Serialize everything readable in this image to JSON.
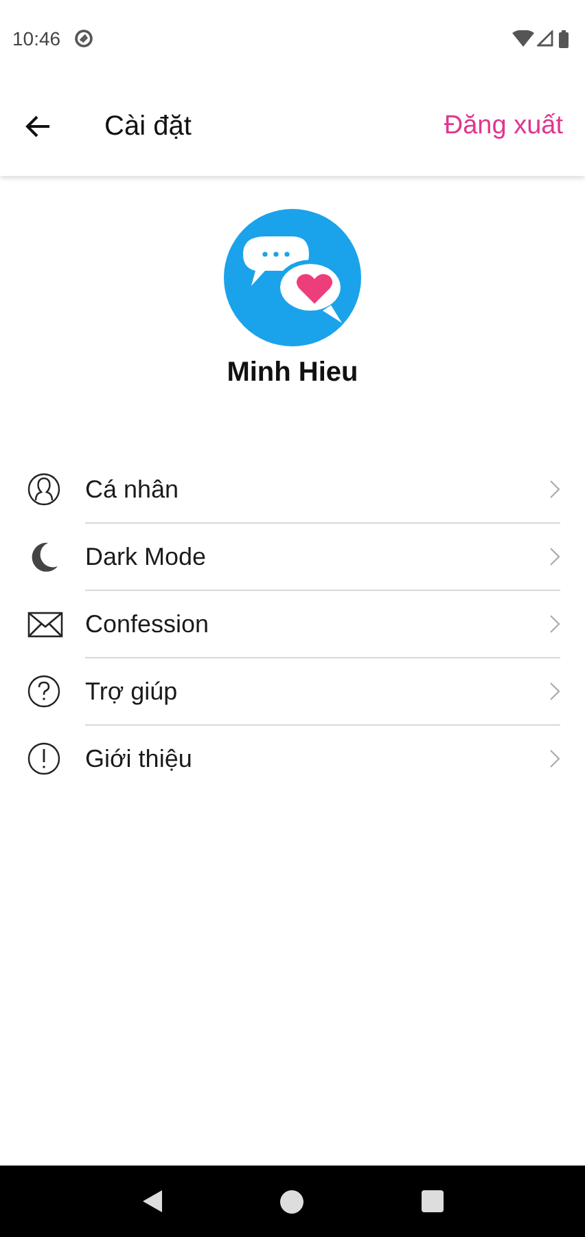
{
  "status_bar": {
    "time": "10:46"
  },
  "app_bar": {
    "title": "Cài đặt",
    "action": "Đăng xuất"
  },
  "profile": {
    "name": "Minh Hieu"
  },
  "menu": [
    {
      "kind": "person",
      "label": "Cá nhân"
    },
    {
      "kind": "moon",
      "label": "Dark Mode"
    },
    {
      "kind": "mail",
      "label": "Confession"
    },
    {
      "kind": "help",
      "label": "Trợ giúp"
    },
    {
      "kind": "info",
      "label": "Giới thiệu"
    }
  ]
}
